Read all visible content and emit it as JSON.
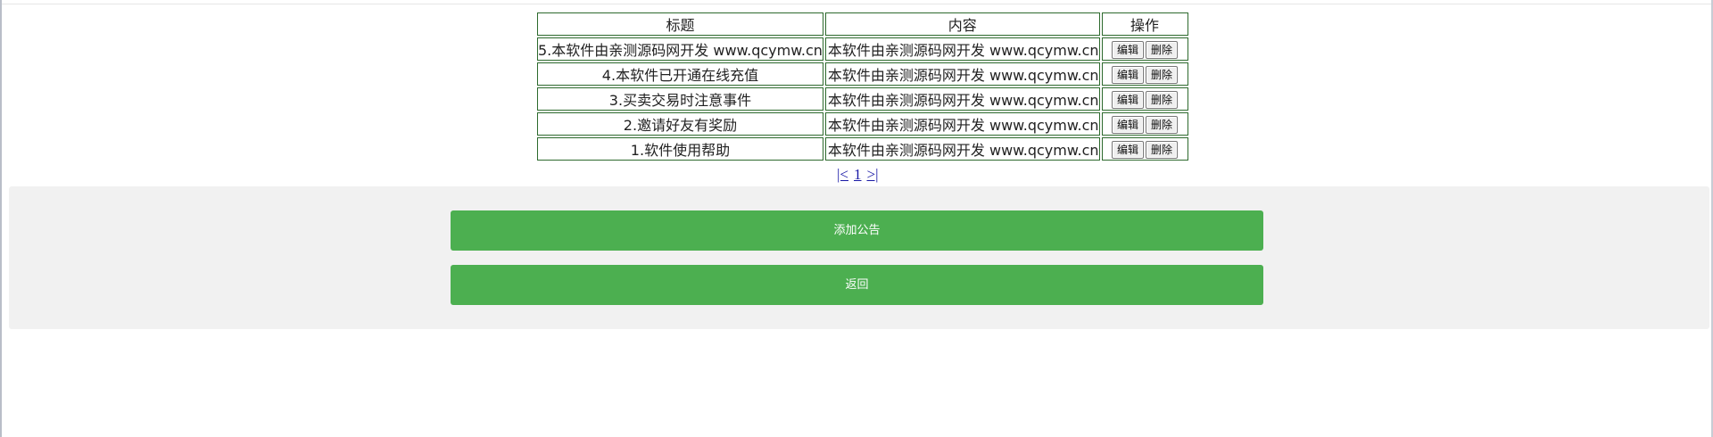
{
  "table": {
    "headers": {
      "title": "标题",
      "content": "内容",
      "actions": "操作"
    },
    "edit_label": "编辑",
    "delete_label": "删除",
    "rows": [
      {
        "title": "5.本软件由亲测源码网开发 www.qcymw.cn",
        "content": "本软件由亲测源码网开发 www.qcymw.cn"
      },
      {
        "title": "4.本软件已开通在线充值",
        "content": "本软件由亲测源码网开发 www.qcymw.cn"
      },
      {
        "title": "3.买卖交易时注意事件",
        "content": "本软件由亲测源码网开发 www.qcymw.cn"
      },
      {
        "title": "2.邀请好友有奖励",
        "content": "本软件由亲测源码网开发 www.qcymw.cn"
      },
      {
        "title": "1.软件使用帮助",
        "content": "本软件由亲测源码网开发 www.qcymw.cn"
      }
    ]
  },
  "pager": {
    "first": "|<",
    "page": "1",
    "last": ">|"
  },
  "buttons": {
    "add_notice": "添加公告",
    "back": "返回"
  },
  "colors": {
    "button_green": "#4caf50",
    "table_border": "#2d6a2d",
    "panel_bg": "#f1f1f1",
    "link_blue": "#1a1aa6"
  }
}
